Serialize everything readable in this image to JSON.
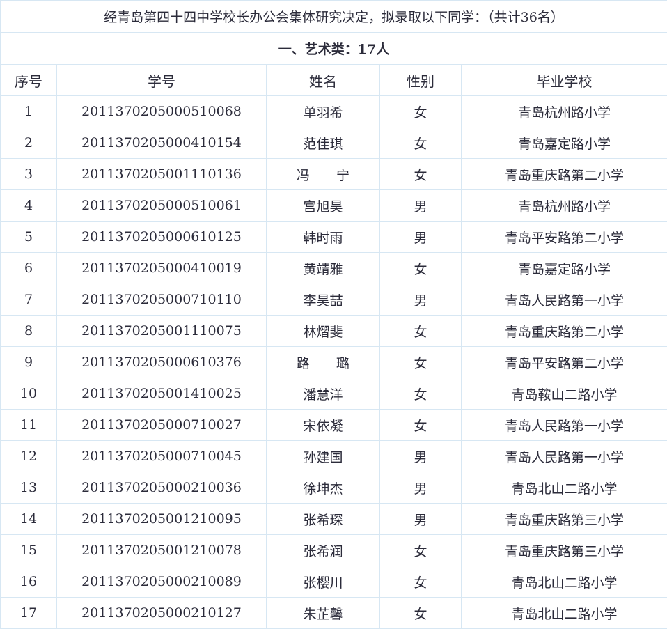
{
  "notice": "经青岛第四十四中学校长办公会集体研究决定，拟录取以下同学：（共计36名）",
  "category_title": "一、艺术类：17人",
  "columns": [
    "序号",
    "学号",
    "姓名",
    "性别",
    "毕业学校"
  ],
  "rows": [
    {
      "idx": "1",
      "id": "2011370205000510068",
      "name": "单羽希",
      "gender": "女",
      "school": "青岛杭州路小学"
    },
    {
      "idx": "2",
      "id": "2011370205000410154",
      "name": "范佳琪",
      "gender": "女",
      "school": "青岛嘉定路小学"
    },
    {
      "idx": "3",
      "id": "2011370205001110136",
      "name": "冯　　宁",
      "gender": "女",
      "school": "青岛重庆路第二小学"
    },
    {
      "idx": "4",
      "id": "2011370205000510061",
      "name": "宫旭昊",
      "gender": "男",
      "school": "青岛杭州路小学"
    },
    {
      "idx": "5",
      "id": "2011370205000610125",
      "name": "韩时雨",
      "gender": "男",
      "school": "青岛平安路第二小学"
    },
    {
      "idx": "6",
      "id": "2011370205000410019",
      "name": "黄靖雅",
      "gender": "女",
      "school": "青岛嘉定路小学"
    },
    {
      "idx": "7",
      "id": "2011370205000710110",
      "name": "李昊喆",
      "gender": "男",
      "school": "青岛人民路第一小学"
    },
    {
      "idx": "8",
      "id": "2011370205001110075",
      "name": "林熠斐",
      "gender": "女",
      "school": "青岛重庆路第二小学"
    },
    {
      "idx": "9",
      "id": "2011370205000610376",
      "name": "路　　璐",
      "gender": "女",
      "school": "青岛平安路第二小学"
    },
    {
      "idx": "10",
      "id": "2011370205001410025",
      "name": "潘慧洋",
      "gender": "女",
      "school": "青岛鞍山二路小学"
    },
    {
      "idx": "11",
      "id": "2011370205000710027",
      "name": "宋依凝",
      "gender": "女",
      "school": "青岛人民路第一小学"
    },
    {
      "idx": "12",
      "id": "2011370205000710045",
      "name": "孙建国",
      "gender": "男",
      "school": "青岛人民路第一小学"
    },
    {
      "idx": "13",
      "id": "2011370205000210036",
      "name": "徐坤杰",
      "gender": "男",
      "school": "青岛北山二路小学"
    },
    {
      "idx": "14",
      "id": "2011370205001210095",
      "name": "张希琛",
      "gender": "男",
      "school": "青岛重庆路第三小学"
    },
    {
      "idx": "15",
      "id": "2011370205001210078",
      "name": "张希润",
      "gender": "女",
      "school": "青岛重庆路第三小学"
    },
    {
      "idx": "16",
      "id": "2011370205000210089",
      "name": "张樱川",
      "gender": "女",
      "school": "青岛北山二路小学"
    },
    {
      "idx": "17",
      "id": "2011370205000210127",
      "name": "朱芷馨",
      "gender": "女",
      "school": "青岛北山二路小学"
    }
  ]
}
